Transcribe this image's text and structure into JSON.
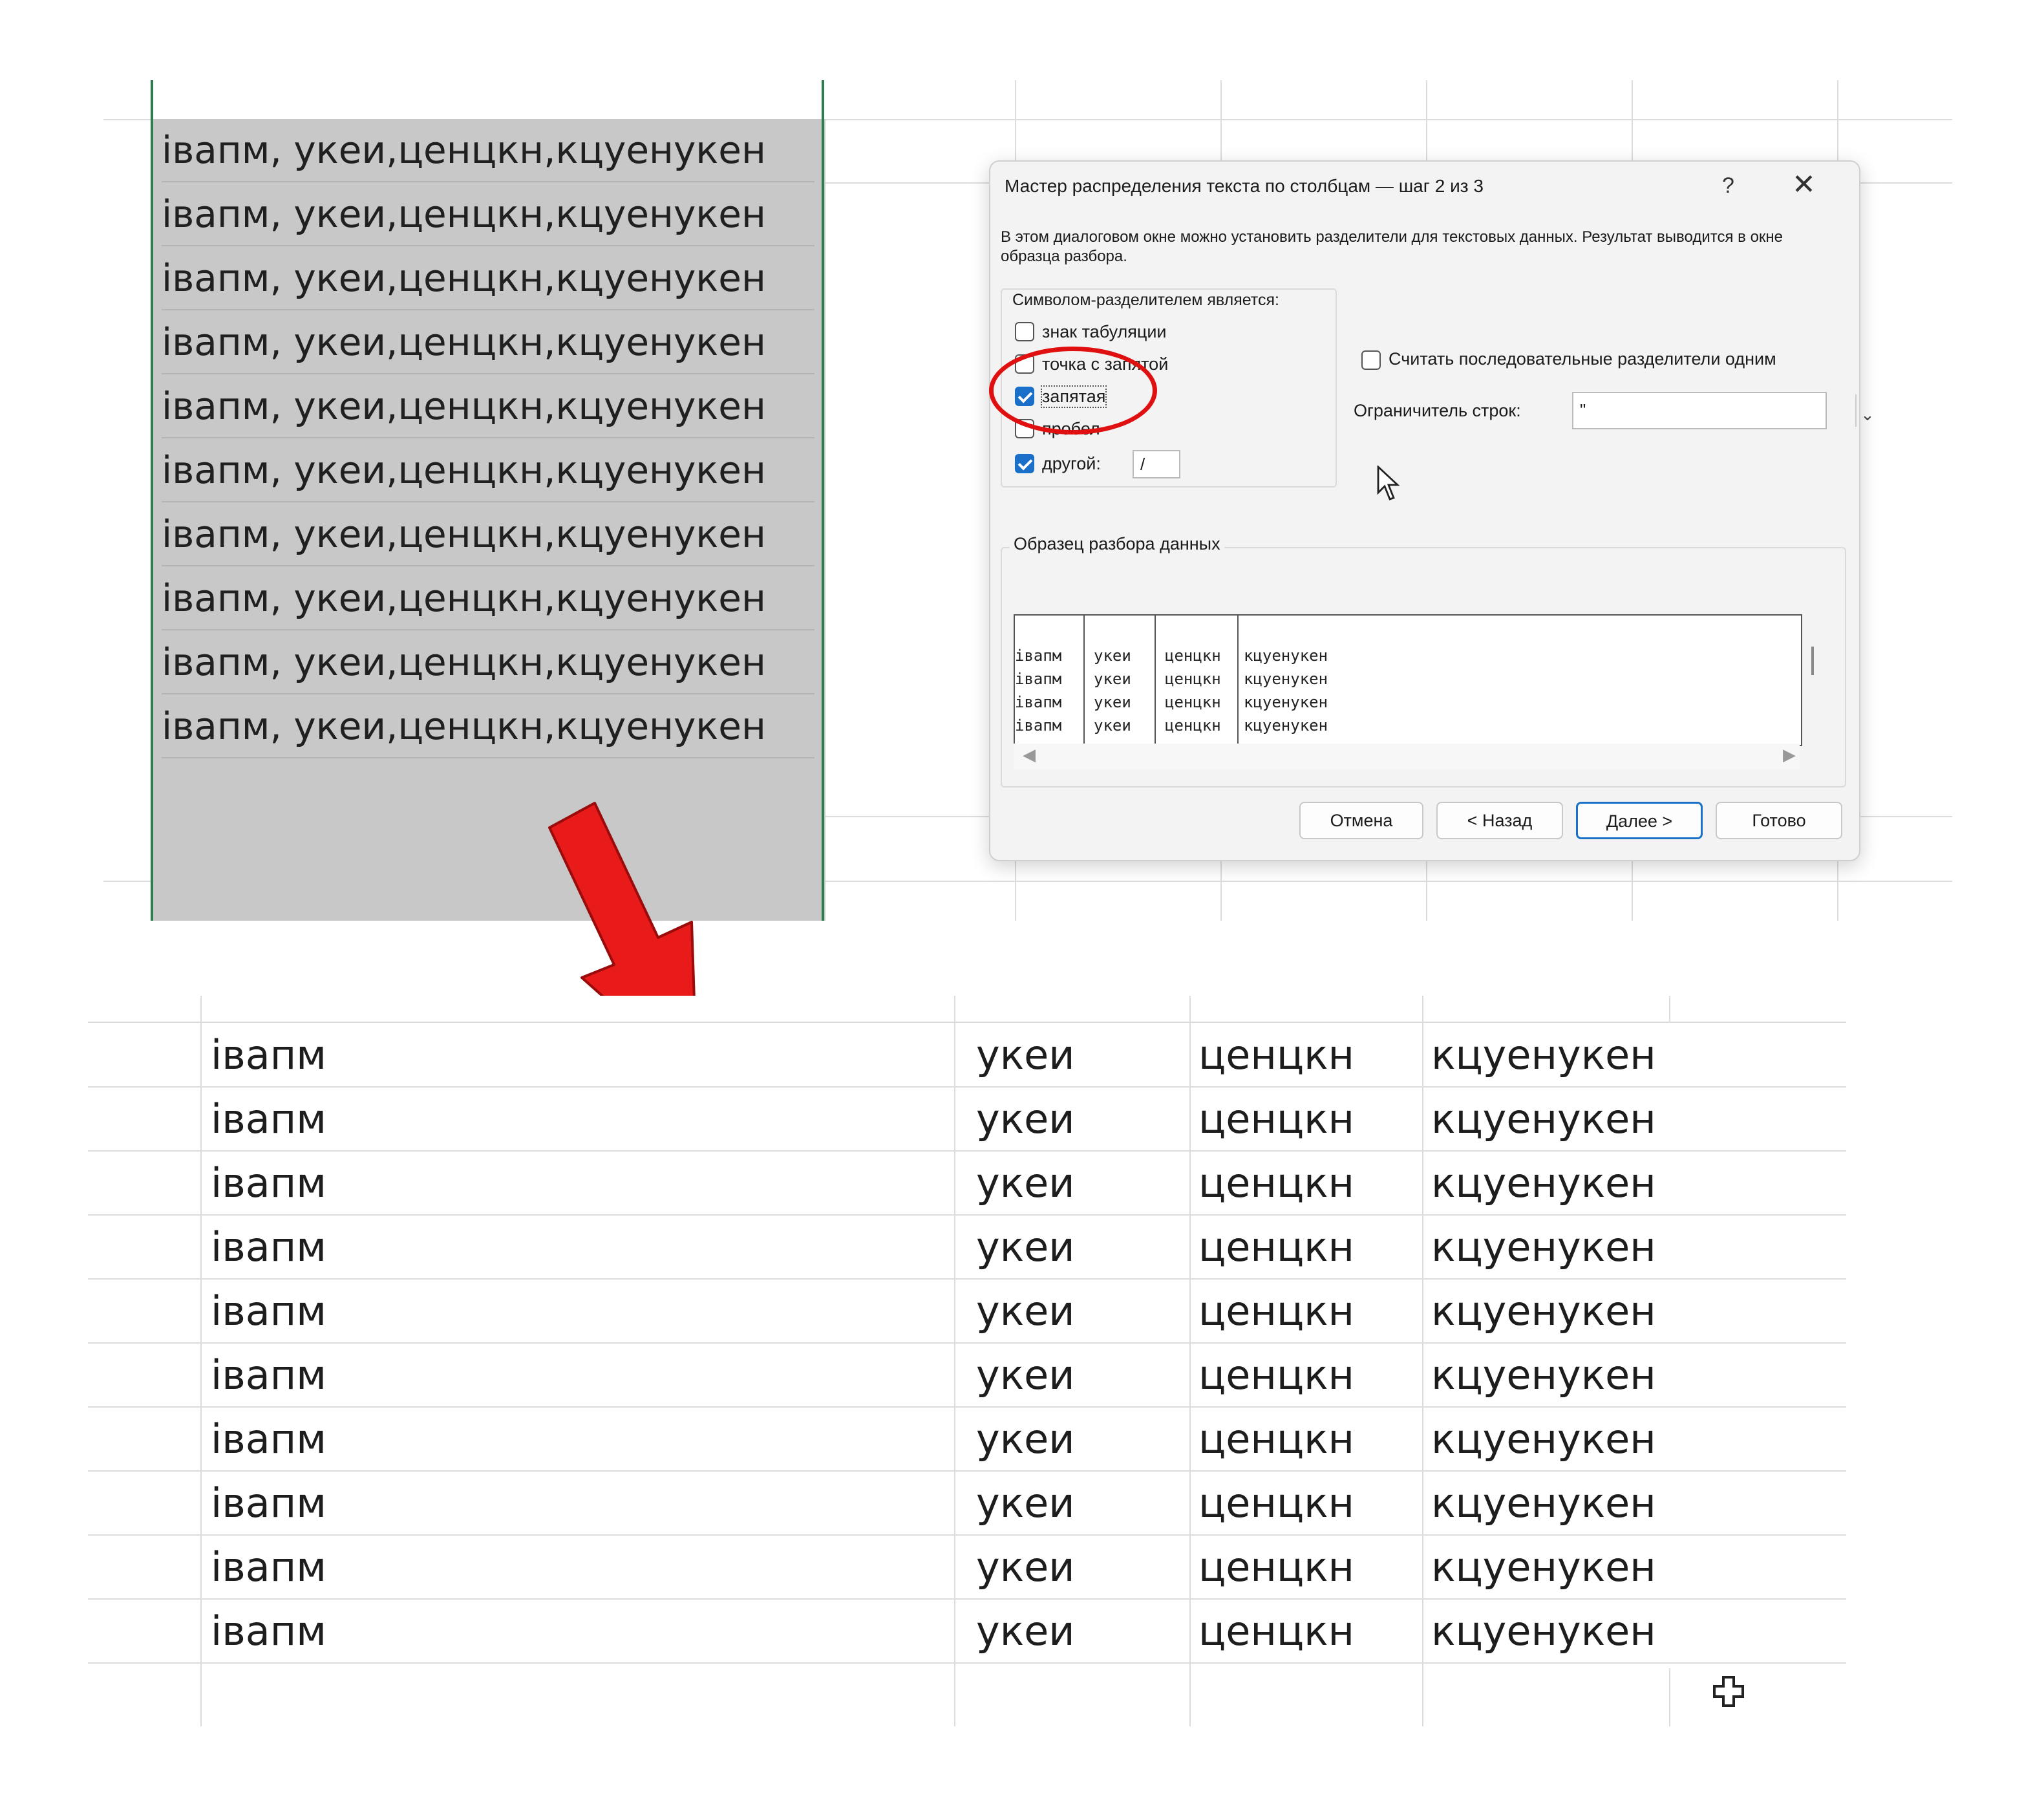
{
  "source_column": {
    "rows": [
      "івапм, укеи,ценцкн,кцуенукен",
      "івапм, укеи,ценцкн,кцуенукен",
      "івапм, укеи,ценцкн,кцуенукен",
      "івапм, укеи,ценцкн,кцуенукен",
      "івапм, укеи,ценцкн,кцуенукен",
      "івапм, укеи,ценцкн,кцуенукен",
      "івапм, укеи,ценцкн,кцуенукен",
      "івапм, укеи,ценцкн,кцуенукен",
      "івапм, укеи,ценцкн,кцуенукен",
      "івапм, укеи,ценцкн,кцуенукен"
    ]
  },
  "dialog": {
    "title": "Мастер распределения текста по столбцам — шаг 2 из 3",
    "help_label": "?",
    "close_label": "✕",
    "description": "В этом диалоговом окне можно установить разделители для текстовых данных. Результат выводится в окне образца разбора.",
    "delimiters_legend": "Символом-разделителем является:",
    "delimiters": [
      {
        "label": "знак табуляции",
        "checked": false
      },
      {
        "label": "точка с запятой",
        "checked": false
      },
      {
        "label": "запятая",
        "checked": true
      },
      {
        "label": "пробел",
        "checked": false
      },
      {
        "label": "другой:",
        "checked": true
      }
    ],
    "other_value": "/",
    "consecutive_label": "Считать последовательные разделители одним",
    "consecutive_checked": false,
    "qualifier_label": "Ограничитель строк:",
    "qualifier_value": "\"",
    "preview_legend": "Образец разбора данных",
    "preview_rows": [
      [
        "івапм",
        "укеи",
        "ценцкн",
        "кцуенукен"
      ],
      [
        "івапм",
        "укеи",
        "ценцкн",
        "кцуенукен"
      ],
      [
        "івапм",
        "укеи",
        "ценцкн",
        "кцуенукен"
      ],
      [
        "івапм",
        "укеи",
        "ценцкн",
        "кцуенукен"
      ]
    ],
    "buttons": {
      "cancel": "Отмена",
      "back": "< Назад",
      "next": "Далее >",
      "finish": "Готово"
    }
  },
  "result_table": {
    "rows": [
      [
        "івапм",
        "укеи",
        "ценцкн",
        "кцуенукен"
      ],
      [
        "івапм",
        "укеи",
        "ценцкн",
        "кцуенукен"
      ],
      [
        "івапм",
        "укеи",
        "ценцкн",
        "кцуенукен"
      ],
      [
        "івапм",
        "укеи",
        "ценцкн",
        "кцуенукен"
      ],
      [
        "івапм",
        "укеи",
        "ценцкн",
        "кцуенукен"
      ],
      [
        "івапм",
        "укеи",
        "ценцкн",
        "кцуенукен"
      ],
      [
        "івапм",
        "укеи",
        "ценцкн",
        "кцуенукен"
      ],
      [
        "івапм",
        "укеи",
        "ценцкн",
        "кцуенукен"
      ],
      [
        "івапм",
        "укеи",
        "ценцкн",
        "кцуенукен"
      ],
      [
        "івапм",
        "укеи",
        "ценцкн",
        "кцуенукен"
      ]
    ]
  },
  "icons": {
    "arrow": "red-arrow-down-right-icon",
    "cursor": "mouse-pointer-icon",
    "fill": "excel-cross-cursor-icon"
  },
  "colors": {
    "highlight": "#e01010",
    "selection_border": "#2e7d4f",
    "accent": "#1a6fc9"
  }
}
